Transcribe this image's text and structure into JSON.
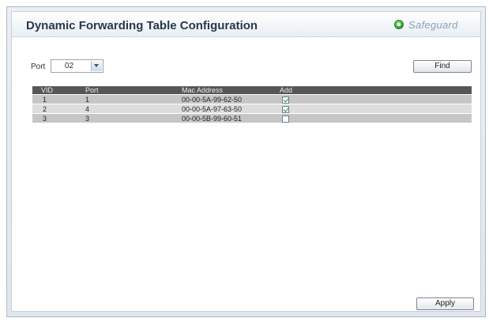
{
  "header": {
    "title": "Dynamic Forwarding Table Configuration",
    "safeguard_label": "Safeguard",
    "safeguard_icon": "status-circle-icon",
    "safeguard_color": "#2f9a2f"
  },
  "filter": {
    "port_label": "Port",
    "port_value": "02",
    "find_label": "Find"
  },
  "table": {
    "columns": [
      "VID",
      "Port",
      "Mac Address",
      "Add"
    ],
    "rows": [
      {
        "vid": "1",
        "port": "1",
        "mac": "00-00-5A-99-62-50",
        "add": true
      },
      {
        "vid": "2",
        "port": "4",
        "mac": "00-00-5A-97-63-50",
        "add": true
      },
      {
        "vid": "3",
        "port": "3",
        "mac": "00-00-5B-99-60-51",
        "add": false
      }
    ]
  },
  "footer": {
    "apply_label": "Apply"
  }
}
